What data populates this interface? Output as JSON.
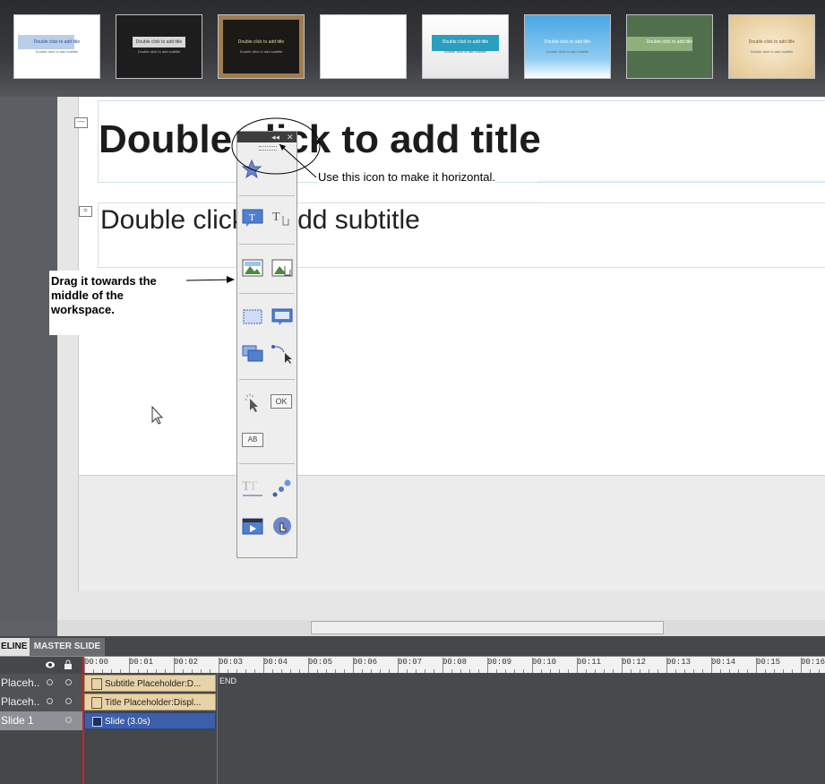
{
  "themes": [
    {
      "title": "Double click to add title",
      "subtitle": "Double click to add subtitle",
      "bg": "#ffffff",
      "fg": "#2a4a9a"
    },
    {
      "title": "Double click to add title",
      "subtitle": "Double click to add subtitle",
      "bg": "#1d1d1d",
      "fg": "#333333"
    },
    {
      "title": "Double click to add title",
      "subtitle": "Double click to add subtitle",
      "bg": "#1c1a17",
      "fg": "#e9d9a6"
    },
    {
      "title": "",
      "subtitle": "",
      "bg": "#ffffff",
      "fg": "#333333"
    },
    {
      "title": "Double click to add title",
      "subtitle": "Double click to add subtitle",
      "bg": "#f3f3f3",
      "fg": "#ffffff"
    },
    {
      "title": "Double click to add title",
      "subtitle": "Double click to add subtitle",
      "bg": "#55aee6",
      "fg": "#ffffff"
    },
    {
      "title": "Double click to add title",
      "subtitle": "Double click to add subtitle",
      "bg": "#4f6f4d",
      "fg": "#ffffff"
    },
    {
      "title": "Double click to add title",
      "subtitle": "Double click to add subtitle",
      "bg": "#f2dfb7",
      "fg": "#7a5a2a"
    }
  ],
  "slide": {
    "title_placeholder": "Double click to add title",
    "subtitle_placeholder": "Double click to add subtitle"
  },
  "annotations": {
    "horizontal_note": "Use this icon to make it horizontal.",
    "drag_note_lines": [
      "Drag it towards the",
      "middle of the",
      "workspace."
    ]
  },
  "toolbar": {
    "icons": [
      "star-icon",
      "text-caption-icon",
      "text-rollover-icon",
      "image-icon",
      "image-rollover-icon",
      "highlight-box-icon",
      "rollover-slidelet-icon",
      "zoom-area-icon",
      "mouse-path-icon",
      "click-box-icon",
      "button-icon",
      "text-entry-box-icon",
      "text-animation-icon",
      "animation-icon",
      "video-icon",
      "interaction-icon"
    ],
    "ok_label": "OK",
    "ab_label": "AB"
  },
  "timeline": {
    "tabs": [
      "ELINE",
      "MASTER SLIDE"
    ],
    "ticks": [
      "00:00",
      "00:01",
      "00:02",
      "00:03",
      "00:04",
      "00:05",
      "00:06",
      "00:07",
      "00:08",
      "00:09",
      "00:10",
      "00:11",
      "00:12",
      "00:13",
      "00:14",
      "00:15",
      "00:16"
    ],
    "end_label": "END",
    "tracks": [
      {
        "label": "Placeh..",
        "bar": "Subtitle Placeholder:D..."
      },
      {
        "label": "Placeh..",
        "bar": "Title Placeholder:Displ..."
      },
      {
        "label": "Slide 1",
        "bar": "Slide (3.0s)"
      }
    ]
  },
  "colors": {
    "accent_blue": "#3d5ea8",
    "placeholder_bar": "#e8d3a8",
    "slide_bar": "#3d5ea8",
    "playhead": "#cc2222"
  }
}
